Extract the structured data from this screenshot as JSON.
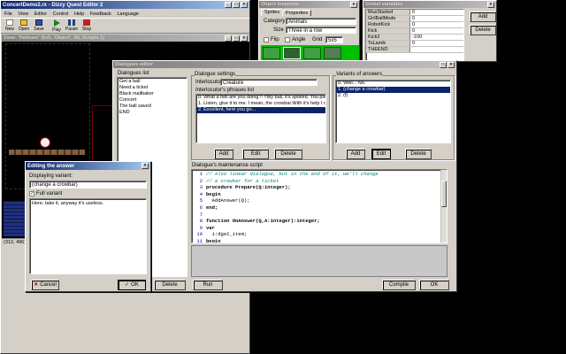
{
  "main_window": {
    "title": "ConcertDemo2.rx - Dizzy Quest Editor 2",
    "menu": [
      "File",
      "View",
      "Editor",
      "Control",
      "Help",
      "Feedback",
      "Language"
    ],
    "toolbar": [
      "New",
      "Open",
      "Save",
      "Play",
      "Pause",
      "Stop"
    ],
    "zone_title": "Zone: 'Helloser' (5x5, 'Object', S5, Scripts 1)",
    "status_coords": "(312, 496)"
  },
  "object_inspector": {
    "title": "Object Inspector",
    "tabs": [
      "Sprites",
      "Properties"
    ],
    "category_label": "Category",
    "category_value": "Animals",
    "size_label": "Size",
    "size_value": "Three in a row",
    "flip_label": "Flip",
    "angle_label": "Angle",
    "grid_label": "Grid",
    "grid_value": "5x5"
  },
  "global_variables": {
    "title": "Global variables",
    "rows": [
      {
        "key": "MusStarted",
        "value": "0"
      },
      {
        "key": "GirlBallMode",
        "value": "0"
      },
      {
        "key": "RobotKick",
        "value": "0"
      },
      {
        "key": "Kick",
        "value": "0"
      },
      {
        "key": "Kick2",
        "value": "-100"
      },
      {
        "key": "TsLamik",
        "value": "0"
      },
      {
        "key": "THEEND",
        "value": ""
      }
    ],
    "add_label": "Add",
    "delete_label": "Delete"
  },
  "dialogue_editor": {
    "title": "Dialogues editor",
    "dialogues_list_label": "Dialogues list",
    "dialogues": [
      "Get a ball",
      "Need a ticket",
      "Black mailbaker",
      "Concert",
      "The ball saved",
      "END"
    ],
    "delete_label": "Delete",
    "settings_label": "Dialogue settings",
    "interlocutor_label": "Interlocutor",
    "interlocutor_value": "Creature",
    "phrases_label": "Interlocutor's phrases list",
    "phrases": [
      "0. What a hell are you doing?! !!My ball, it's spoiled. You pierce it by",
      "1. Listen, give it to me. I mean, the crowbar.With it's help I could get",
      "2. Excellent, here you go..."
    ],
    "phrases_selected": 2,
    "answers_label": "Variants of answers",
    "answers": [
      "0. Well... No.",
      "1. (change a crowbar)",
      "2. (f)"
    ],
    "answers_selected": 1,
    "add_label": "Add",
    "edit_label": "Edit",
    "script_label": "Dialogue's maintenance script",
    "script_lines": [
      {
        "n": "1",
        "text": "// Also linear dialogue, but in the end of it, we'll change",
        "kind": "comment"
      },
      {
        "n": "2",
        "text": "// a crowbar for a ticket",
        "kind": "comment"
      },
      {
        "n": "3",
        "text": "procedure Prepare(Q:integer);",
        "kind": "kw"
      },
      {
        "n": "4",
        "text": "begin",
        "kind": "kw"
      },
      {
        "n": "5",
        "text": "  AddAnswer(Q);",
        "kind": "plain"
      },
      {
        "n": "6",
        "text": "end;",
        "kind": "kw"
      },
      {
        "n": "7",
        "text": "",
        "kind": "plain"
      },
      {
        "n": "8",
        "text": "function OnAnswer(Q,A:integer):integer;",
        "kind": "kw"
      },
      {
        "n": "9",
        "text": "var",
        "kind": "kw"
      },
      {
        "n": "10",
        "text": "  i:dge2_item;",
        "kind": "plain"
      },
      {
        "n": "11",
        "text": "begin",
        "kind": "kw"
      }
    ],
    "run_label": "Run",
    "compile_label": "Compile",
    "ok_label": "OK"
  },
  "editing_answer": {
    "title": "Editing the answer",
    "displaying_label": "Displaying variant:",
    "displaying_value": "(change a crowbar)",
    "full_variant_label": "Full variant",
    "full_variant_text": "Here, take it, anyway it's useless.",
    "cancel_label": "Cancel",
    "ok_label": "OK"
  }
}
